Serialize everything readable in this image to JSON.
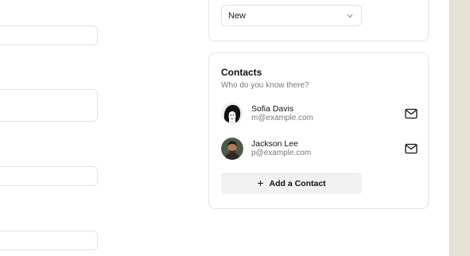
{
  "status_card": {
    "select_value": "New"
  },
  "contacts": {
    "title": "Contacts",
    "subtitle": "Who do you know there?",
    "items": [
      {
        "name": "Sofia Davis",
        "email": "m@example.com"
      },
      {
        "name": "Jackson Lee",
        "email": "p@example.com"
      }
    ],
    "add_label": "Add a Contact",
    "add_icon": "+"
  },
  "icons": {
    "select": "chevron-down-icon",
    "contact_action": "mail-icon",
    "add": "plus-icon"
  },
  "colors": {
    "side_strip": "#e6e3d6",
    "button_bg": "#f1f1f1",
    "muted_text": "#7a7a7a"
  }
}
